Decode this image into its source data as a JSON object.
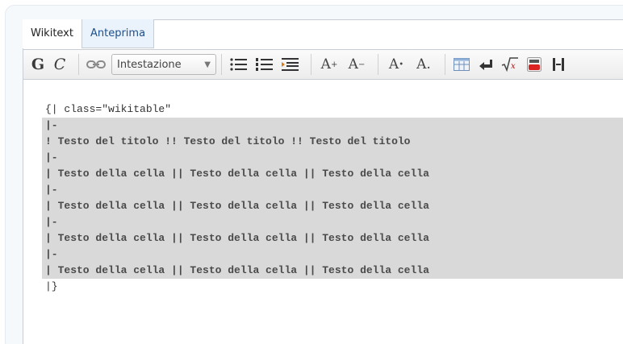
{
  "tabs": [
    {
      "label": "Wikitext"
    },
    {
      "label": "Anteprima"
    }
  ],
  "toolbar": {
    "bold_label": "G",
    "italic_label": "C",
    "heading_select_value": "Intestazione",
    "font_bigger_label": "A",
    "font_smaller_label": "A",
    "superscript_label": "A",
    "subscript_label": "A."
  },
  "code_lines": [
    "{| class=\"wikitable\"",
    "|-",
    "! Testo del titolo !! Testo del titolo !! Testo del titolo",
    "|-",
    "| Testo della cella || Testo della cella || Testo della cella",
    "|-",
    "| Testo della cella || Testo della cella || Testo della cella",
    "|-",
    "| Testo della cella || Testo della cella || Testo della cella",
    "|-",
    "| Testo della cella || Testo della cella || Testo della cella",
    "|}"
  ],
  "colors": {
    "selection": "#d9d9d9",
    "tab_inactive_bg": "#eaf2fb",
    "tab_inactive_text": "#1e4f8b"
  }
}
